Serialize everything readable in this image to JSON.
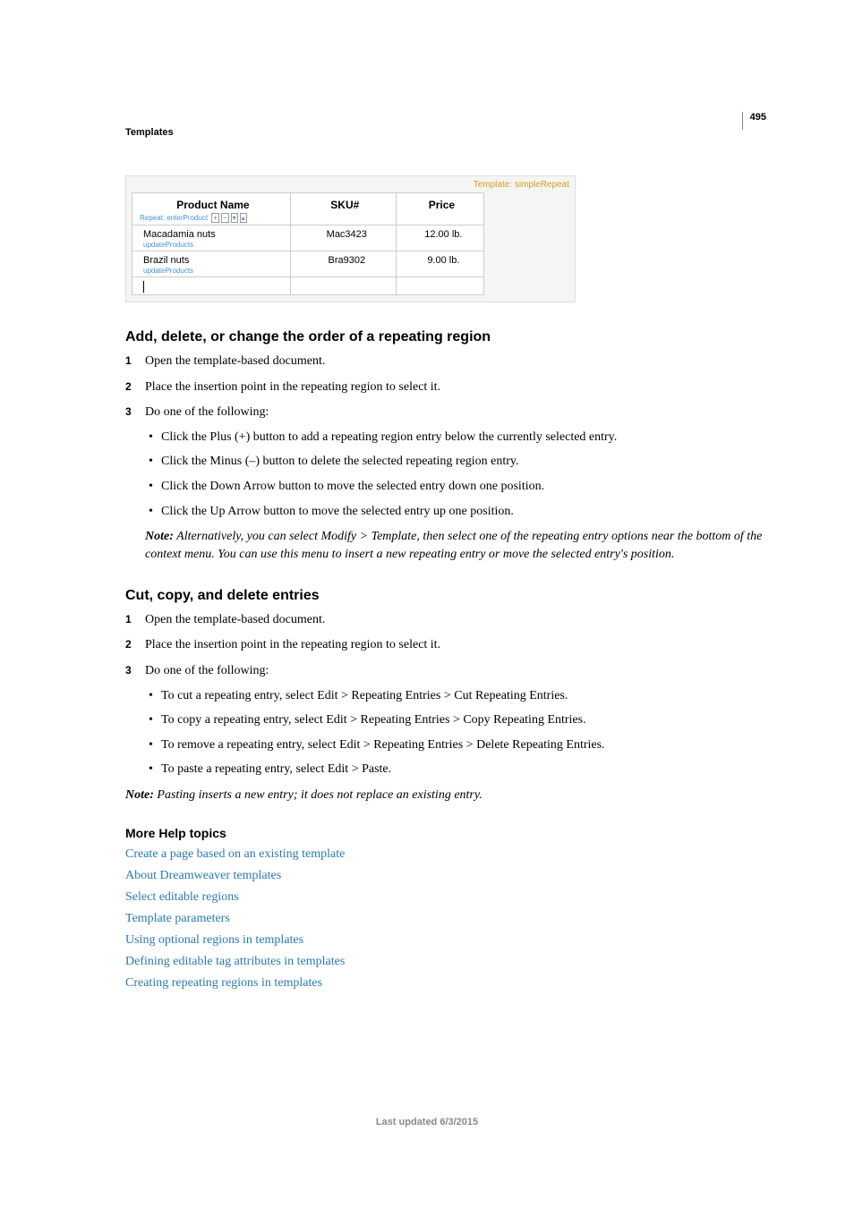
{
  "page_number": "495",
  "header": "Templates",
  "figure": {
    "template_label": "Template: simpleRepeat",
    "headers": {
      "c1": "Product Name",
      "c2": "SKU#",
      "c3": "Price"
    },
    "repeat_label": "Repeat: enterProduct",
    "rows": [
      {
        "name": "Macadamia nuts",
        "update": "updateProducts",
        "sku": "Mac3423",
        "price": "12.00 lb."
      },
      {
        "name": "Brazil nuts",
        "update": "updateProducts",
        "sku": "Bra9302",
        "price": "9.00 lb."
      }
    ]
  },
  "section1": {
    "heading": "Add, delete, or change the order of a repeating region",
    "steps": {
      "s1": "Open the template-based document.",
      "s2": "Place the insertion point in the repeating region to select it.",
      "s3": "Do one of the following:",
      "bullets": {
        "b1": "Click the Plus (+) button to add a repeating region entry below the currently selected entry.",
        "b2": "Click the Minus (–) button to delete the selected repeating region entry.",
        "b3": "Click the Down Arrow button to move the selected entry down one position.",
        "b4": "Click the Up Arrow button to move the selected entry up one position."
      }
    },
    "note_label": "Note:",
    "note": "Alternatively, you can select Modify > Template, then select one of the repeating entry options near the bottom of the context menu. You can use this menu to insert a new repeating entry or move the selected entry's position."
  },
  "section2": {
    "heading": "Cut, copy, and delete entries",
    "steps": {
      "s1": "Open the template-based document.",
      "s2": "Place the insertion point in the repeating region to select it.",
      "s3": "Do one of the following:",
      "bullets": {
        "b1": "To cut a repeating entry, select Edit > Repeating Entries > Cut Repeating Entries.",
        "b2": "To copy a repeating entry, select Edit > Repeating Entries > Copy Repeating Entries.",
        "b3": "To remove a repeating entry, select Edit > Repeating Entries > Delete Repeating Entries.",
        "b4": "To paste a repeating entry, select Edit > Paste."
      }
    },
    "note_label": "Note:",
    "note": "Pasting inserts a new entry; it does not replace an existing entry."
  },
  "more_help": {
    "heading": "More Help topics",
    "links": {
      "l1": "Create a page based on an existing template",
      "l2": "About Dreamweaver templates",
      "l3": "Select editable regions",
      "l4": "Template parameters",
      "l5": "Using optional regions in templates",
      "l6": "Defining editable tag attributes in templates",
      "l7": "Creating repeating regions in templates"
    }
  },
  "footer": "Last updated 6/3/2015"
}
